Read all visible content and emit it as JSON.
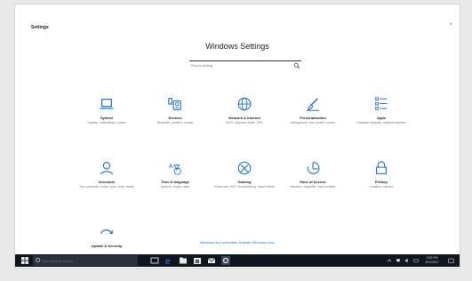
{
  "window": {
    "title": "Settings",
    "close_glyph": "×"
  },
  "header": {
    "title": "Windows Settings"
  },
  "search": {
    "placeholder": "Find a setting",
    "icon": "search-icon"
  },
  "tiles": [
    {
      "name": "System",
      "desc": "Display, notifications, power",
      "icon": "laptop-icon"
    },
    {
      "name": "Devices",
      "desc": "Bluetooth, printers, mouse",
      "icon": "devices-icon"
    },
    {
      "name": "Network & Internet",
      "desc": "Wi-Fi, airplane mode, VPN",
      "icon": "globe-icon"
    },
    {
      "name": "Personalization",
      "desc": "Background, lock screen, colors",
      "icon": "brush-icon"
    },
    {
      "name": "Apps",
      "desc": "Uninstall, defaults, optional features",
      "icon": "apps-list-icon"
    },
    {
      "name": "Accounts",
      "desc": "Your accounts, email, sync, work, family",
      "icon": "person-icon"
    },
    {
      "name": "Time & language",
      "desc": "Speech, region, date",
      "icon": "time-language-icon"
    },
    {
      "name": "Gaming",
      "desc": "Game bar, DVR, broadcasting, Game Mode",
      "icon": "xbox-icon"
    },
    {
      "name": "Ease of Access",
      "desc": "Narrator, magnifier, high contrast",
      "icon": "ease-of-access-icon"
    },
    {
      "name": "Privacy",
      "desc": "Location, camera",
      "icon": "lock-icon"
    },
    {
      "name": "Update & Security",
      "desc": "",
      "icon": "update-icon"
    }
  ],
  "footer": {
    "link": "Windows isn't activated. Activate Windows now."
  },
  "taskbar": {
    "search_placeholder": "Type here to search",
    "clock_time": "2:00 PM",
    "clock_date": "10/1/2017"
  },
  "colors": {
    "accent": "#1a73c7",
    "taskbar": "#10161f"
  }
}
